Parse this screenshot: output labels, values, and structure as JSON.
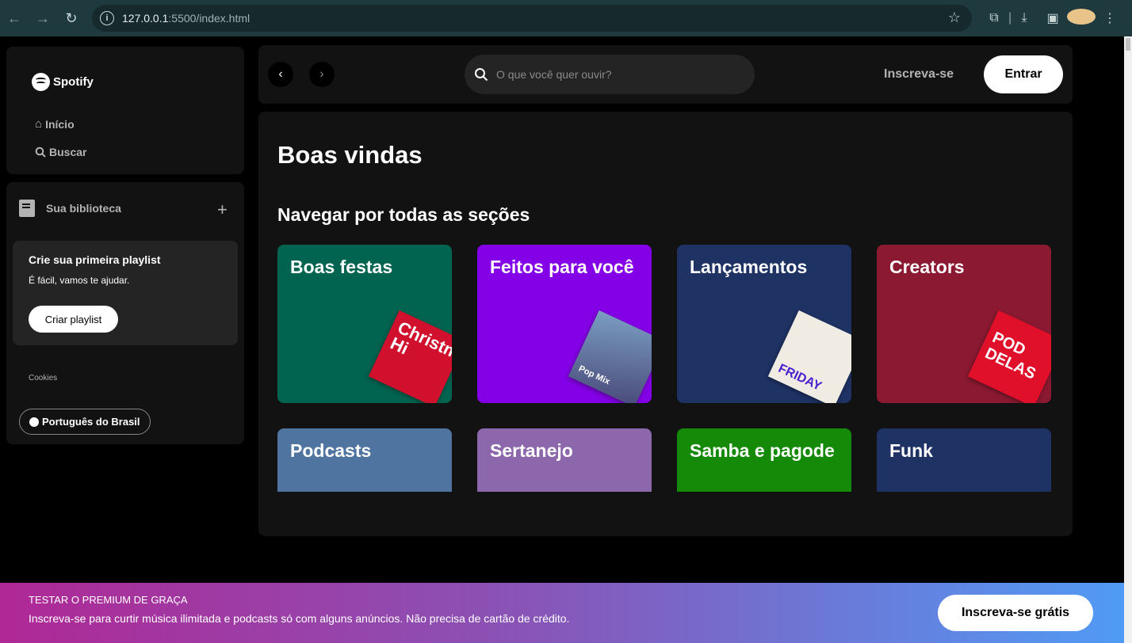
{
  "browser": {
    "url_host": "127.0.0.1",
    "url_path": ":5500/index.html"
  },
  "sidebar": {
    "brand": "Spotify",
    "nav": [
      {
        "label": "Início",
        "icon": "home-icon"
      },
      {
        "label": "Buscar",
        "icon": "search-icon"
      }
    ],
    "library_title": "Sua biblioteca",
    "playlist_card": {
      "title": "Crie sua primeira playlist",
      "subtitle": "É fácil, vamos te ajudar.",
      "button": "Criar playlist"
    },
    "cookies": "Cookies",
    "language": "Português do Brasil"
  },
  "header": {
    "search_placeholder": "O que você quer ouvir?",
    "signup": "Inscreva-se",
    "login": "Entrar"
  },
  "main": {
    "welcome": "Boas vindas",
    "section_title": "Navegar por todas as seções",
    "genres": [
      {
        "label": "Boas festas",
        "color": "#006450",
        "cover_text": "Christm Hi",
        "cover_color": "#d0102c"
      },
      {
        "label": "Feitos para você",
        "color": "#8400e7",
        "cover_text": "Pop Mix",
        "cover_color": "#7a9ec2"
      },
      {
        "label": "Lançamentos",
        "color": "#1e3264",
        "cover_text": "FRIDAY",
        "cover_color": "#f0ece3"
      },
      {
        "label": "Creators",
        "color": "#8c1932",
        "cover_text": "POD DELAS",
        "cover_color": "#e0102a"
      },
      {
        "label": "Podcasts",
        "color": "#4f74a0"
      },
      {
        "label": "Sertanejo",
        "color": "#8c67ab"
      },
      {
        "label": "Samba e pagode",
        "color": "#148a08"
      },
      {
        "label": "Funk",
        "color": "#1e3264"
      }
    ]
  },
  "banner": {
    "title": "TESTAR O PREMIUM DE GRAÇA",
    "text": "Inscreva-se para curtir música ilimitada e podcasts só com alguns anúncios. Não precisa de cartão de crédito.",
    "button": "Inscreva-se grátis"
  }
}
